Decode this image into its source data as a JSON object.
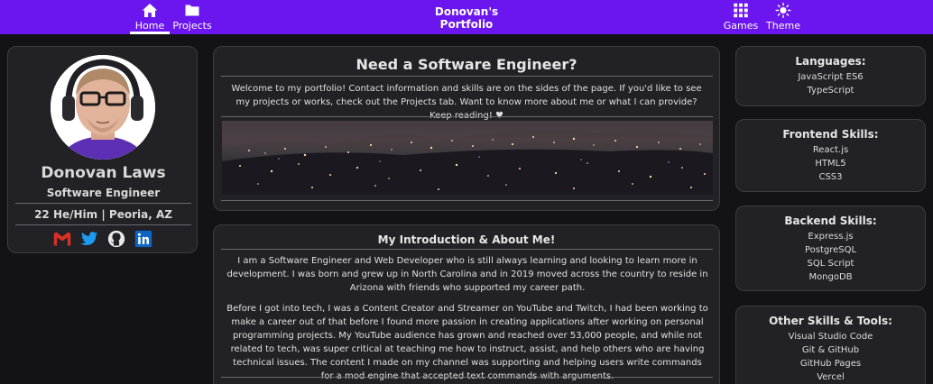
{
  "nav": {
    "home_label": "Home",
    "projects_label": "Projects",
    "brand_line1": "Donovan's",
    "brand_line2": "Portfolio",
    "games_label": "Games",
    "theme_label": "Theme",
    "bar_color": "#6b16ef"
  },
  "profile": {
    "name": "Donovan Laws",
    "title": "Software Engineer",
    "location": "22 He/Him | Peoria, AZ",
    "socials": [
      "gmail-icon",
      "twitter-icon",
      "github-icon",
      "linkedin-icon"
    ]
  },
  "hero": {
    "title": "Need a Software Engineer?",
    "text": "Welcome to my portfolio! Contact information and skills are on the sides of the page. If you'd like to see my projects or works, check out the Projects tab. Want to know more about me or what I can provide? Keep reading! ♥"
  },
  "about": {
    "title": "My Introduction & About Me!",
    "p1": "I am a Software Engineer and Web Developer who is still always learning and looking to learn more in development. I was born and grew up in North Carolina and in 2019 moved across the country to reside in Arizona with friends who supported my career path.",
    "p2": "Before I got into tech, I was a Content Creator and Streamer on YouTube and Twitch, I had been working to make a career out of that before I found more passion in creating applications after working on personal programming projects. My YouTube audience has grown and reached over 53,000 people, and while not related to tech, was super critical at teaching me how to instruct, assist, and help others who are having technical issues. The content I made on my channel was supporting and helping users write commands for a mod engine that accepted text commands with arguments."
  },
  "skills": {
    "languages": {
      "title": "Languages:",
      "items": [
        "JavaScript ES6",
        "TypeScript"
      ]
    },
    "frontend": {
      "title": "Frontend Skills:",
      "items": [
        "React.js",
        "HTML5",
        "CSS3"
      ]
    },
    "backend": {
      "title": "Backend Skills:",
      "items": [
        "Express.js",
        "PostgreSQL",
        "SQL Script",
        "MongoDB"
      ]
    },
    "other": {
      "title": "Other Skills & Tools:",
      "items": [
        "Visual Studio Code",
        "Git & GitHub",
        "GitHub Pages",
        "Vercel"
      ]
    }
  }
}
